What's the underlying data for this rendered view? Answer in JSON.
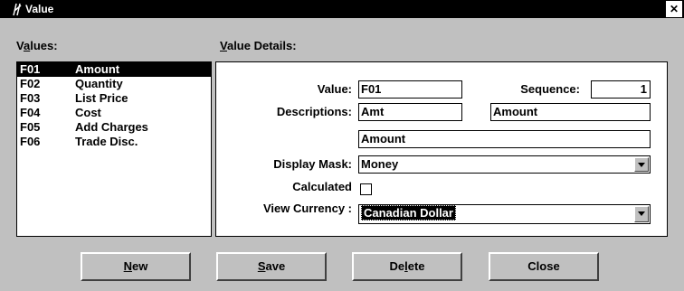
{
  "window": {
    "title": "Value",
    "close_glyph": "✕"
  },
  "values_label_prefix": "V",
  "values_label_ul": "a",
  "values_label_rest": "lues:",
  "details_label_ul": "V",
  "details_label_rest": "alue Details:",
  "values": [
    {
      "code": "F01",
      "name": "Amount",
      "selected": true
    },
    {
      "code": "F02",
      "name": "Quantity"
    },
    {
      "code": "F03",
      "name": "List Price"
    },
    {
      "code": "F04",
      "name": "Cost"
    },
    {
      "code": "F05",
      "name": "Add Charges"
    },
    {
      "code": "F06",
      "name": "Trade Disc."
    }
  ],
  "fields": {
    "value_label": "Value:",
    "value": "F01",
    "sequence_label": "Sequence:",
    "sequence": "1",
    "descriptions_label": "Descriptions:",
    "desc_short": "Amt",
    "desc_long": "Amount",
    "desc_third": "Amount",
    "display_mask_label": "Display Mask:",
    "display_mask": "Money",
    "calculated_label": "Calculated",
    "calculated_checked": false,
    "view_currency_label": "View Currency :",
    "view_currency": "Canadian Dollar"
  },
  "buttons": {
    "new_ul": "N",
    "new_rest": "ew",
    "save_ul": "S",
    "save_rest": "ave",
    "delete_pre": "De",
    "delete_ul": "l",
    "delete_rest": "ete",
    "close": "Close"
  }
}
